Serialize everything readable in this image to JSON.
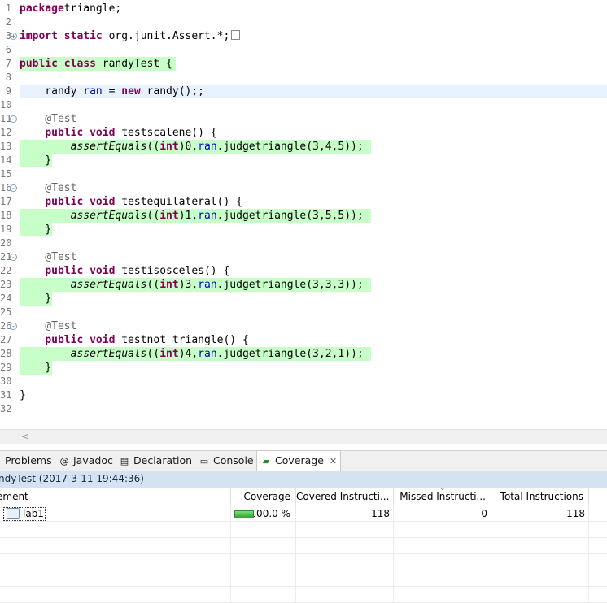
{
  "editor": {
    "lines": [
      {
        "n": "1",
        "parts": [
          [
            "kw",
            "package"
          ],
          [
            "",
            "triangle;"
          ]
        ]
      },
      {
        "n": "2",
        "parts": []
      },
      {
        "n": "3",
        "fold": "+",
        "parts": [
          [
            "kw",
            "import static"
          ],
          [
            "",
            " org.junit.Assert.*;"
          ]
        ],
        "box": true
      },
      {
        "n": "6",
        "parts": []
      },
      {
        "n": "7",
        "hl": "green-full",
        "parts": [
          [
            "kw",
            "public class"
          ],
          [
            "",
            " randyTest {"
          ]
        ]
      },
      {
        "n": "8",
        "parts": []
      },
      {
        "n": "9",
        "hl": "blue",
        "parts": [
          [
            "",
            "    randy "
          ],
          [
            "fld",
            "ran"
          ],
          [
            "",
            " = "
          ],
          [
            "kw",
            "new"
          ],
          [
            "",
            " randy();;"
          ]
        ]
      },
      {
        "n": "10",
        "parts": []
      },
      {
        "n": "11",
        "fold": "-",
        "parts": [
          [
            "ann",
            "    @Test"
          ]
        ]
      },
      {
        "n": "12",
        "parts": [
          [
            "",
            "    "
          ],
          [
            "kw",
            "public void"
          ],
          [
            "",
            " testscalene() {"
          ]
        ]
      },
      {
        "n": "13",
        "hl": "green",
        "parts": [
          [
            "",
            "        "
          ],
          [
            "stat",
            "assertEquals"
          ],
          [
            "",
            "(("
          ],
          [
            "kw",
            "int"
          ],
          [
            "",
            ")0,"
          ],
          [
            "fld",
            "ran"
          ],
          [
            "",
            ".judgetriangle(3,4,5));"
          ]
        ]
      },
      {
        "n": "14",
        "hl": "green-short",
        "parts": [
          [
            "",
            "    }"
          ]
        ]
      },
      {
        "n": "15",
        "parts": []
      },
      {
        "n": "16",
        "fold": "-",
        "parts": [
          [
            "ann",
            "    @Test"
          ]
        ]
      },
      {
        "n": "17",
        "parts": [
          [
            "",
            "    "
          ],
          [
            "kw",
            "public void"
          ],
          [
            "",
            " testequilateral() {"
          ]
        ]
      },
      {
        "n": "18",
        "hl": "green",
        "parts": [
          [
            "",
            "        "
          ],
          [
            "stat",
            "assertEquals"
          ],
          [
            "",
            "(("
          ],
          [
            "kw",
            "int"
          ],
          [
            "",
            ")1,"
          ],
          [
            "fld",
            "ran"
          ],
          [
            "",
            ".judgetriangle(3,5,5));"
          ]
        ]
      },
      {
        "n": "19",
        "hl": "green-short",
        "parts": [
          [
            "",
            "    }"
          ]
        ]
      },
      {
        "n": "20",
        "parts": []
      },
      {
        "n": "21",
        "fold": "-",
        "parts": [
          [
            "ann",
            "    @Test"
          ]
        ]
      },
      {
        "n": "22",
        "parts": [
          [
            "",
            "    "
          ],
          [
            "kw",
            "public void"
          ],
          [
            "",
            " testisosceles() {"
          ]
        ]
      },
      {
        "n": "23",
        "hl": "green",
        "parts": [
          [
            "",
            "        "
          ],
          [
            "stat",
            "assertEquals"
          ],
          [
            "",
            "(("
          ],
          [
            "kw",
            "int"
          ],
          [
            "",
            ")3,"
          ],
          [
            "fld",
            "ran"
          ],
          [
            "",
            ".judgetriangle(3,3,3));"
          ]
        ]
      },
      {
        "n": "24",
        "hl": "green-short",
        "parts": [
          [
            "",
            "    }"
          ]
        ]
      },
      {
        "n": "25",
        "parts": []
      },
      {
        "n": "26",
        "fold": "-",
        "parts": [
          [
            "ann",
            "    @Test"
          ]
        ]
      },
      {
        "n": "27",
        "parts": [
          [
            "",
            "    "
          ],
          [
            "kw",
            "public void"
          ],
          [
            "",
            " testnot_triangle() {"
          ]
        ]
      },
      {
        "n": "28",
        "hl": "green",
        "parts": [
          [
            "",
            "        "
          ],
          [
            "stat",
            "assertEquals"
          ],
          [
            "",
            "(("
          ],
          [
            "kw",
            "int"
          ],
          [
            "",
            ")4,"
          ],
          [
            "fld",
            "ran"
          ],
          [
            "",
            ".judgetriangle(3,2,1));"
          ]
        ]
      },
      {
        "n": "29",
        "hl": "green-short",
        "parts": [
          [
            "",
            "    }"
          ]
        ]
      },
      {
        "n": "30",
        "parts": []
      },
      {
        "n": "31",
        "parts": [
          [
            "",
            "}"
          ]
        ]
      },
      {
        "n": "32",
        "parts": []
      }
    ],
    "scroll_arrow": "<"
  },
  "tabs": [
    {
      "label": "Problems",
      "icon": ""
    },
    {
      "label": "Javadoc",
      "icon": "@"
    },
    {
      "label": "Declaration",
      "icon": "▤"
    },
    {
      "label": "Console",
      "icon": "▭"
    },
    {
      "label": "Coverage",
      "icon": "▰",
      "active": true,
      "close": "✕"
    }
  ],
  "session": "ndyTest (2017-3-11 19:44:36)",
  "table": {
    "headers": [
      "ement",
      "Coverage",
      "Covered Instructi...",
      "Missed Instructi...",
      "Total Instructions"
    ],
    "rows": [
      {
        "element": "lab1",
        "coverage": "100.0 %",
        "covered": "118",
        "missed": "0",
        "total": "118"
      }
    ]
  }
}
